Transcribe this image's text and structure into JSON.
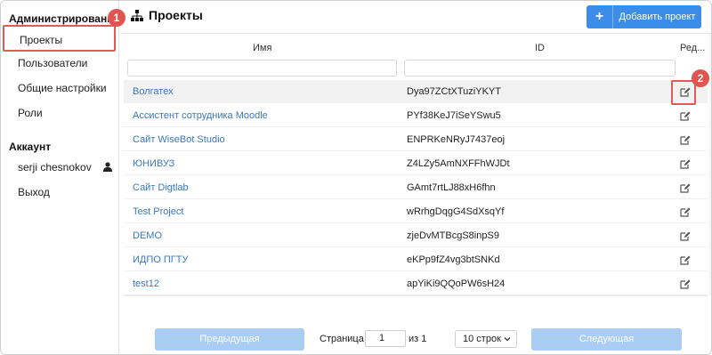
{
  "sidebar": {
    "section_admin": "Администрирование",
    "admin_items": [
      {
        "label": "Проекты"
      },
      {
        "label": "Пользователи"
      },
      {
        "label": "Общие настройки"
      },
      {
        "label": "Роли"
      }
    ],
    "section_account": "Аккаунт",
    "account_items": [
      {
        "label": "serji chesnokov"
      },
      {
        "label": "Выход"
      }
    ]
  },
  "badges": {
    "first": "1",
    "second": "2"
  },
  "header": {
    "title": "Проекты",
    "add_button": "Добавить проект"
  },
  "table": {
    "columns": {
      "name": "Имя",
      "id": "ID",
      "edit": "Ред..."
    },
    "rows": [
      {
        "name": "Волгатех",
        "id": "Dya97ZCtXTuziYKYT"
      },
      {
        "name": "Ассистент сотрудника Moodle",
        "id": "PYf38KeJ7iSeYSwu5"
      },
      {
        "name": "Сайт WiseBot Studio",
        "id": "ENPRKeNRyJ7437eoj"
      },
      {
        "name": "ЮНИВУЗ",
        "id": "Z4LZy5AmNXFFhWJDt"
      },
      {
        "name": "Сайт Digtlab",
        "id": "GAmt7rtLJ88xH6fhn"
      },
      {
        "name": "Test Project",
        "id": "wRrhgDqgG4SdXsqYf"
      },
      {
        "name": "DEMO",
        "id": "zjeDvMTBcgS8inpS9"
      },
      {
        "name": "ИДПО ПГТУ",
        "id": "eKPp9fZ4vg3btSNKd"
      },
      {
        "name": "test12",
        "id": "apYiKi9QQoPW6sH24"
      }
    ]
  },
  "pagination": {
    "prev": "Предыдущая",
    "page_label": "Страница",
    "page_value": "1",
    "of_label": "из 1",
    "rows_select": "10 строк",
    "next": "Следующая"
  },
  "colors": {
    "accent": "#3c8dea",
    "link": "#3a78c0",
    "highlight": "#e05a5a"
  }
}
